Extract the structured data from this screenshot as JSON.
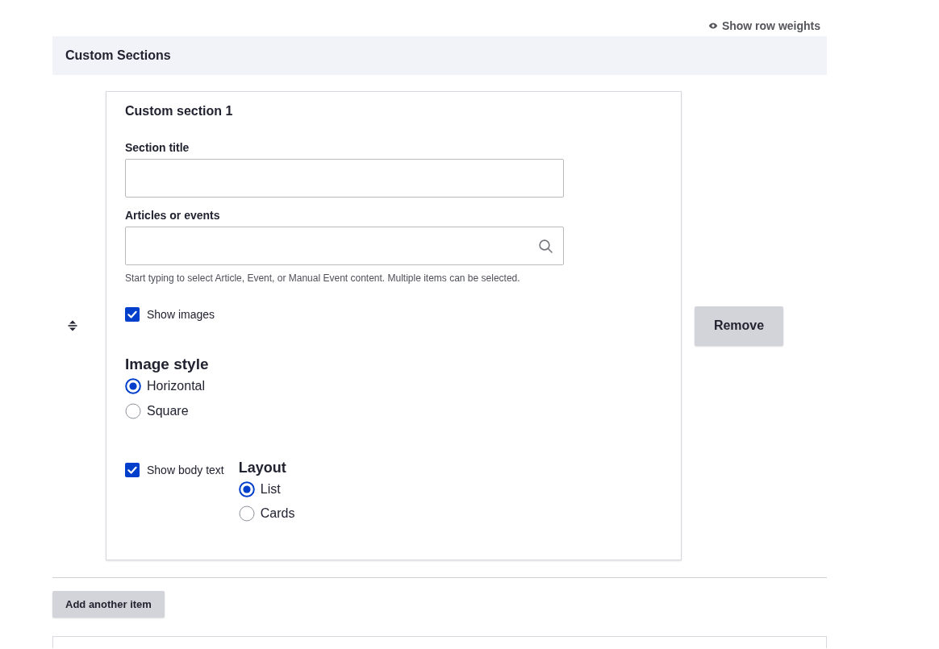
{
  "show_row_weights": "Show row weights",
  "table_header": "Custom Sections",
  "items": [
    {
      "heading": "Custom section 1",
      "section_title": {
        "label": "Section title"
      },
      "articles": {
        "label": "Articles or events",
        "description": "Start typing to select Article, Event, or Manual Event content. Multiple items can be selected."
      },
      "show_images": {
        "label": "Show images",
        "checked": true
      },
      "image_style": {
        "legend": "Image style",
        "options": [
          {
            "label": "Horizontal",
            "selected": true
          },
          {
            "label": "Square",
            "selected": false
          }
        ]
      },
      "show_body_text": {
        "label": "Show body text",
        "checked": true
      },
      "layout": {
        "legend": "Layout",
        "options": [
          {
            "label": "List",
            "selected": true
          },
          {
            "label": "Cards",
            "selected": false
          }
        ]
      },
      "remove_button": "Remove"
    }
  ],
  "add_button": "Add another item"
}
